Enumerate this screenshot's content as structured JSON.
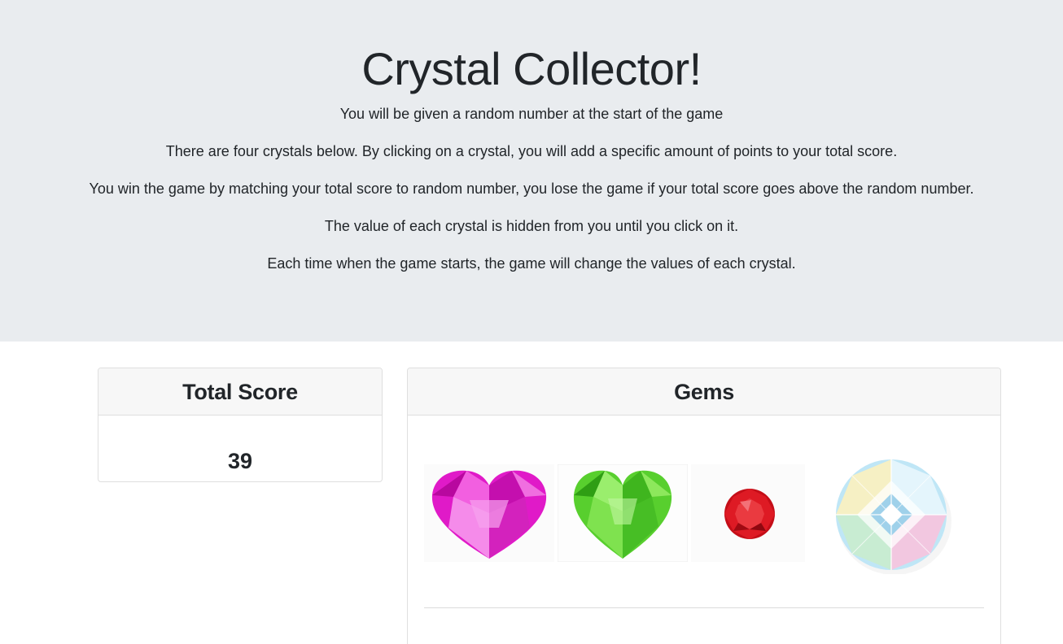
{
  "header": {
    "title": "Crystal Collector!",
    "instructions": [
      "You will be given a random number at the start of the game",
      "There are four crystals below. By clicking on a crystal, you will add a specific amount of points to your total score.",
      "You win the game by matching your total score to random number, you lose the game if your total score goes above the random number.",
      "The value of each crystal is hidden from you until you click on it.",
      "Each time when the game starts, the game will change the values of each crystal."
    ]
  },
  "score_panel": {
    "title": "Total Score",
    "value": "39"
  },
  "gems_panel": {
    "title": "Gems",
    "gems": [
      {
        "name": "pink-heart-gem",
        "color": "#e81fd0"
      },
      {
        "name": "green-heart-gem",
        "color": "#5fd634"
      },
      {
        "name": "red-round-gem",
        "color": "#d0111b"
      },
      {
        "name": "diamond-gem",
        "color": "#9fd8f0"
      }
    ]
  },
  "colors": {
    "jumbotron_bg": "#e9ecef",
    "card_header_bg": "#f7f7f7",
    "text": "#212529"
  }
}
